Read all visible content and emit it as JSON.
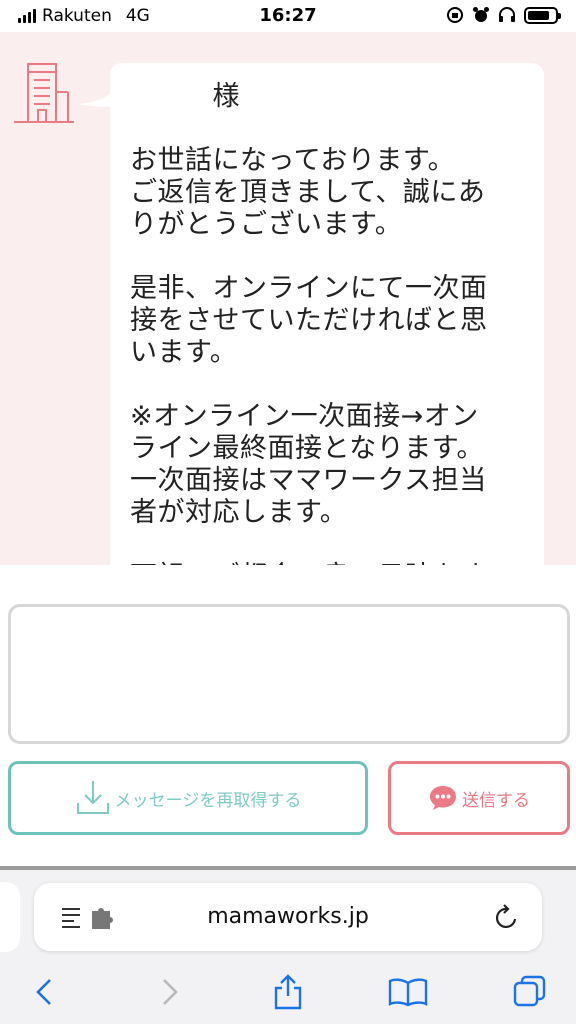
{
  "status_bar": {
    "carrier": "Rakuten",
    "network": "4G",
    "time": "16:27",
    "battery_level": 0.8
  },
  "chat": {
    "avatar_icon": "building-icon",
    "accent_color": "#ea7a84",
    "background_color": "#fbeeee",
    "message": "　　　様\n\nお世話になっております。\nご返信を頂きまして、誠にあ\nりがとうございます。\n\n是非、オンラインにて一次面\n接をさせていただければと思\nいます。\n\n※オンライン一次面接→オン\nライン最終面接となります。\n一次面接はママワークス担当\n者が対応します。\n\n下記でご都合の良い日時をす"
  },
  "compose": {
    "input_value": "",
    "refetch_label": "メッセージを再取得する",
    "refetch_icon": "download-icon",
    "send_label": "送信する",
    "send_icon": "chat-bubble-icon",
    "teal_color": "#6cc4bd"
  },
  "browser": {
    "url": "mamaworks.jp",
    "icons": [
      "reader-extension-icon",
      "reload-icon",
      "back-icon",
      "forward-icon",
      "share-icon",
      "bookmarks-icon",
      "tabs-icon"
    ],
    "tint_color": "#1a73e8"
  }
}
